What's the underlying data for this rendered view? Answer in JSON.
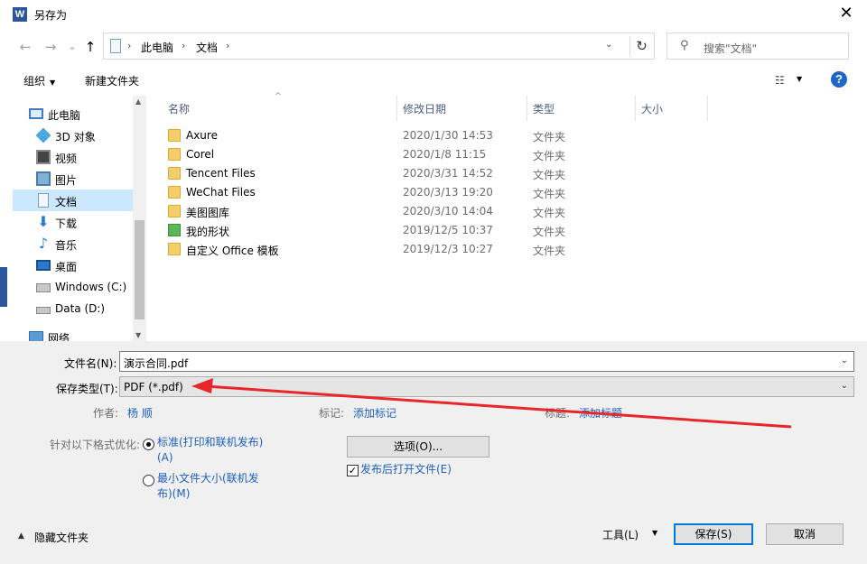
{
  "window": {
    "title": "另存为",
    "app_icon_letter": "W",
    "close_glyph": "✕"
  },
  "nav": {
    "back": "←",
    "forward": "→",
    "dropdown": "⌄",
    "up": "↑",
    "address_parts": [
      "此电脑",
      "文档"
    ],
    "address_sep": "›",
    "refresh": "↻",
    "search_placeholder": "搜索\"文档\""
  },
  "toolbar": {
    "organize": "组织",
    "new_folder": "新建文件夹",
    "help": "?"
  },
  "sidebar": {
    "items": [
      {
        "label": "此电脑",
        "icon": "computer-icon"
      },
      {
        "label": "3D 对象",
        "icon": "3d-objects-icon"
      },
      {
        "label": "视频",
        "icon": "video-icon"
      },
      {
        "label": "图片",
        "icon": "pictures-icon"
      },
      {
        "label": "文档",
        "icon": "documents-icon",
        "selected": true
      },
      {
        "label": "下载",
        "icon": "download-icon"
      },
      {
        "label": "音乐",
        "icon": "music-icon"
      },
      {
        "label": "桌面",
        "icon": "desktop-icon"
      },
      {
        "label": "Windows (C:)",
        "icon": "drive-c-icon"
      },
      {
        "label": "Data (D:)",
        "icon": "drive-d-icon"
      },
      {
        "label": "网络",
        "icon": "network-icon"
      }
    ]
  },
  "file_list": {
    "columns": [
      "名称",
      "修改日期",
      "类型",
      "大小"
    ],
    "rows": [
      {
        "name": "Axure",
        "date": "2020/1/30 14:53",
        "type": "文件夹",
        "icon": "folder-icon"
      },
      {
        "name": "Corel",
        "date": "2020/1/8 11:15",
        "type": "文件夹",
        "icon": "folder-icon"
      },
      {
        "name": "Tencent Files",
        "date": "2020/3/31 14:52",
        "type": "文件夹",
        "icon": "folder-icon"
      },
      {
        "name": "WeChat Files",
        "date": "2020/3/13 19:20",
        "type": "文件夹",
        "icon": "folder-icon"
      },
      {
        "name": "美图图库",
        "date": "2020/3/10 14:04",
        "type": "文件夹",
        "icon": "folder-icon"
      },
      {
        "name": "我的形状",
        "date": "2019/12/5 10:37",
        "type": "文件夹",
        "icon": "shapes-folder-icon"
      },
      {
        "name": "自定义 Office 模板",
        "date": "2019/12/3 10:27",
        "type": "文件夹",
        "icon": "folder-icon"
      }
    ]
  },
  "form": {
    "filename_label": "文件名(N):",
    "filename_value": "演示合同.pdf",
    "filetype_label": "保存类型(T):",
    "filetype_value": "PDF (*.pdf)",
    "author_label": "作者:",
    "author_value": "杨 顺",
    "tags_label": "标记:",
    "tags_value": "添加标记",
    "title_label": "标题:",
    "title_value": "添加标题",
    "optimize_label": "针对以下格式优化:",
    "option1_line1": "标准(打印和联机发布)",
    "option1_line2": "(A)",
    "option2_line1": "最小文件大小(联机发",
    "option2_line2": "布)(M)",
    "options_button": "选项(O)...",
    "open_after_publish": "发布后打开文件(E)",
    "open_after_publish_checked": true
  },
  "footer": {
    "hide_folders": "隐藏文件夹",
    "tools": "工具(L)",
    "save": "保存(S)",
    "cancel": "取消"
  },
  "annotation": {
    "color": "#e8262b"
  }
}
